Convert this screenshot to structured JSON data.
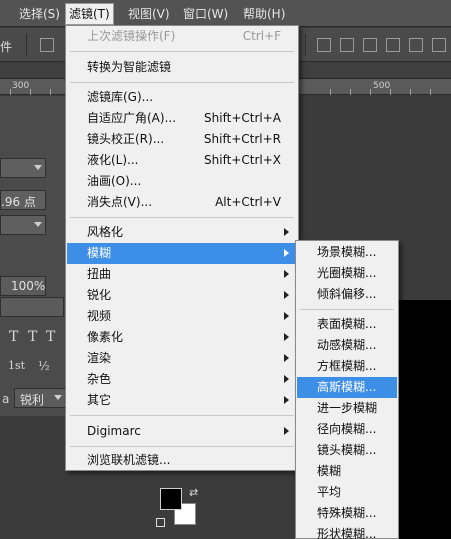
{
  "menubar": {
    "items": [
      {
        "label": "选择(S)"
      },
      {
        "label": "滤镜(T)"
      },
      {
        "label": "视图(V)"
      },
      {
        "label": "窗口(W)"
      },
      {
        "label": "帮助(H)"
      }
    ]
  },
  "options": {
    "partial_label": "件"
  },
  "ruler": {
    "ticks": [
      "300",
      "500"
    ]
  },
  "left_panel": {
    "size_value": ".96 点",
    "percent": "100%",
    "symbols": [
      "T",
      "T",
      "T",
      "1st",
      "½"
    ],
    "antialias": "锐利",
    "antialias_prefix": "a",
    "antialias_prefix2": "a"
  },
  "filter_menu": {
    "items": [
      {
        "label": "上次滤镜操作(F)",
        "shortcut": "Ctrl+F",
        "disabled": true
      },
      {
        "label": "转换为智能滤镜"
      },
      {
        "label": "滤镜库(G)..."
      },
      {
        "label": "自适应广角(A)...",
        "shortcut": "Shift+Ctrl+A"
      },
      {
        "label": "镜头校正(R)...",
        "shortcut": "Shift+Ctrl+R"
      },
      {
        "label": "液化(L)...",
        "shortcut": "Shift+Ctrl+X"
      },
      {
        "label": "油画(O)..."
      },
      {
        "label": "消失点(V)...",
        "shortcut": "Alt+Ctrl+V"
      },
      {
        "label": "风格化"
      },
      {
        "label": "模糊"
      },
      {
        "label": "扭曲"
      },
      {
        "label": "锐化"
      },
      {
        "label": "视频"
      },
      {
        "label": "像素化"
      },
      {
        "label": "渲染"
      },
      {
        "label": "杂色"
      },
      {
        "label": "其它"
      },
      {
        "label": "Digimarc"
      },
      {
        "label": "浏览联机滤镜..."
      }
    ]
  },
  "blur_submenu": {
    "items": [
      {
        "label": "场景模糊..."
      },
      {
        "label": "光圈模糊..."
      },
      {
        "label": "倾斜偏移..."
      },
      {
        "label": "表面模糊..."
      },
      {
        "label": "动感模糊..."
      },
      {
        "label": "方框模糊..."
      },
      {
        "label": "高斯模糊..."
      },
      {
        "label": "进一步模糊"
      },
      {
        "label": "径向模糊..."
      },
      {
        "label": "镜头模糊..."
      },
      {
        "label": "模糊"
      },
      {
        "label": "平均"
      },
      {
        "label": "特殊模糊..."
      },
      {
        "label": "形状模糊..."
      }
    ]
  },
  "colors": {
    "menu_highlight": "#3d8ee6",
    "foreground": "#000000",
    "background": "#ffffff"
  }
}
